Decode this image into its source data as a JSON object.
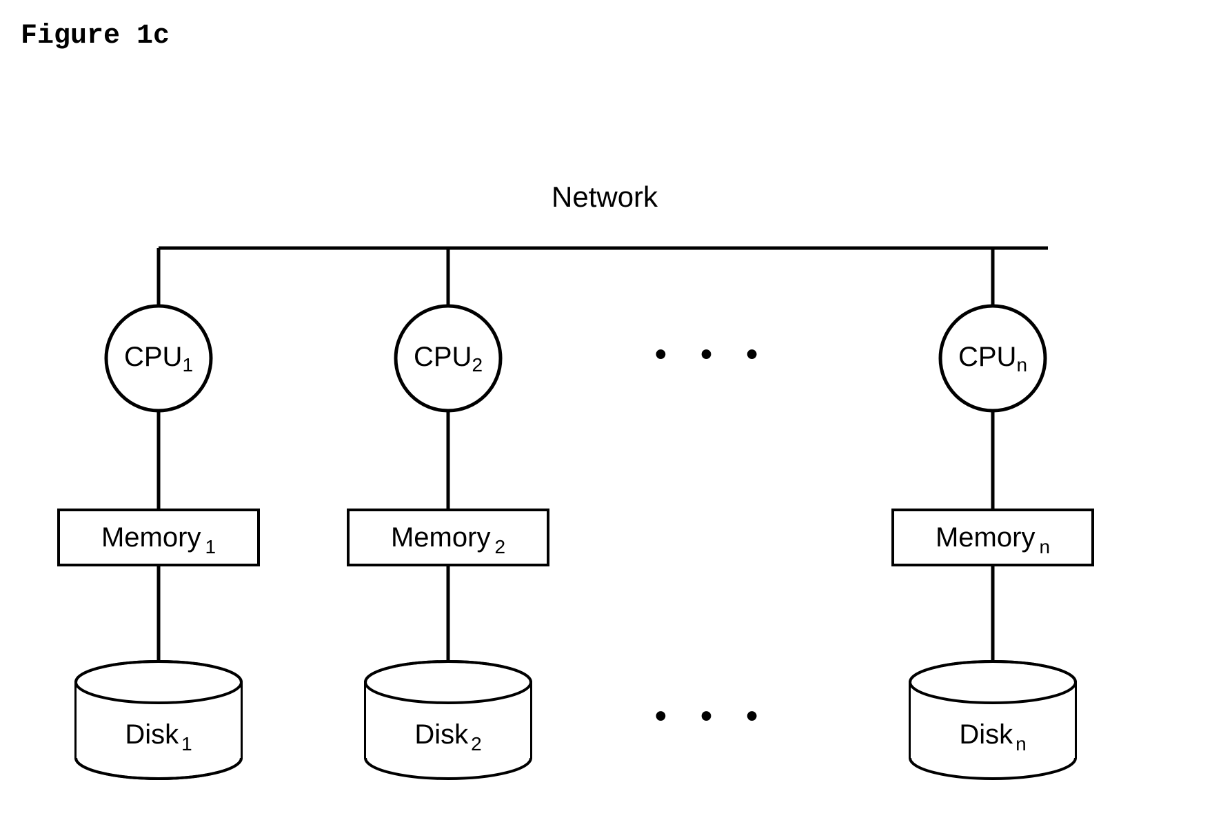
{
  "title": "Figure 1c",
  "network_label": "Network",
  "ellipsis": "• • •",
  "nodes": [
    {
      "cpu_base": "CPU",
      "cpu_sub": "1",
      "mem_base": "Memory",
      "mem_sub": "1",
      "disk_base": "Disk",
      "disk_sub": "1"
    },
    {
      "cpu_base": "CPU",
      "cpu_sub": "2",
      "mem_base": "Memory",
      "mem_sub": "2",
      "disk_base": "Disk",
      "disk_sub": "2"
    },
    {
      "cpu_base": "CPU",
      "cpu_sub": "n",
      "mem_base": "Memory",
      "mem_sub": "n",
      "disk_base": "Disk",
      "disk_sub": "n"
    }
  ]
}
